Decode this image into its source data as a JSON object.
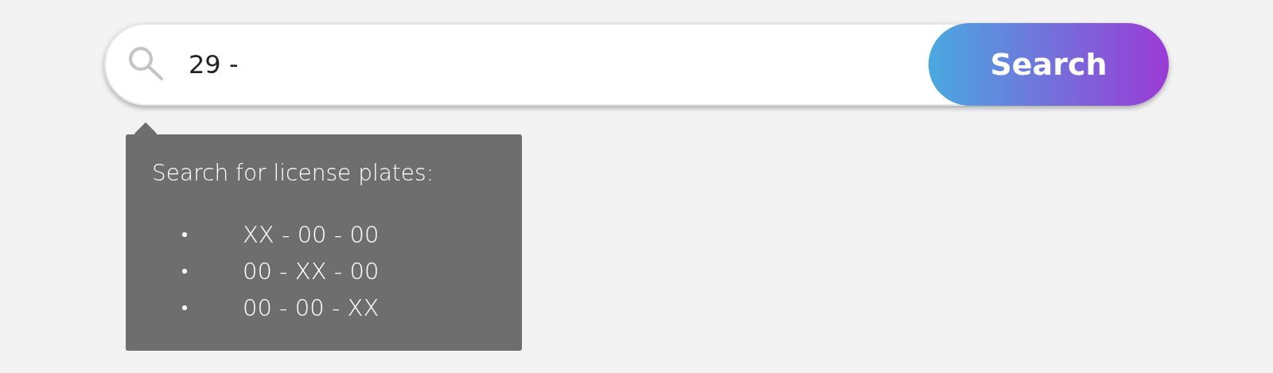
{
  "search": {
    "value": "29 -",
    "button": "Search"
  },
  "tooltip": {
    "title": "Search for license plates:",
    "formats": [
      "XX - 00 - 00",
      "00 - XX - 00",
      "00 - 00 - XX"
    ]
  }
}
